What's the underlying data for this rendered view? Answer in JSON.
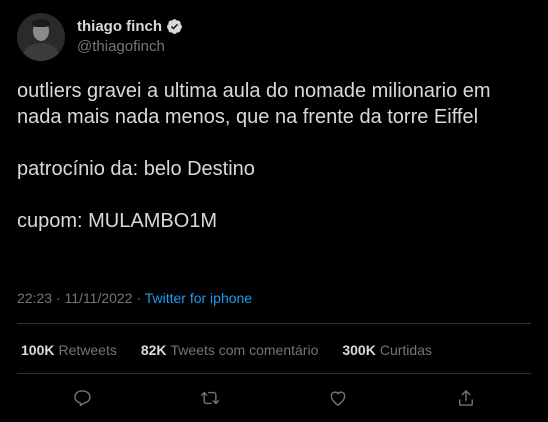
{
  "author": {
    "display_name": "thiago finch",
    "handle": "@thiagofinch",
    "verified": true
  },
  "tweet": {
    "paragraphs": [
      "outliers gravei a ultima aula do nomade milionario em nada mais nada menos, que na frente da torre Eiffel",
      "patrocínio da: belo Destino",
      "cupom: MULAMBO1M"
    ],
    "time": "22:23",
    "separator": "·",
    "date": "11/11/2022",
    "source": "Twitter for iphone"
  },
  "stats": {
    "retweets_count": "100K",
    "retweets_label": "Retweets",
    "quotes_count": "82K",
    "quotes_label": "Tweets com comentário",
    "likes_count": "300K",
    "likes_label": "Curtidas"
  },
  "actions": {
    "reply_icon": "reply-icon",
    "retweet_icon": "retweet-icon",
    "like_icon": "heart-icon",
    "share_icon": "share-icon"
  },
  "colors": {
    "background": "#000000",
    "text_primary": "#d9d9d9",
    "text_secondary": "#6e767d",
    "accent": "#1d9bf0",
    "divider": "#2f3336"
  }
}
